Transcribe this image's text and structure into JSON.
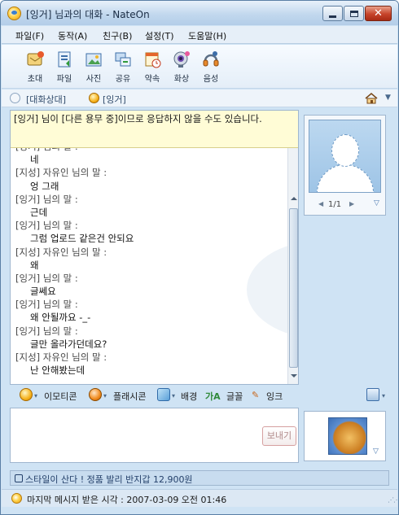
{
  "window": {
    "title": "[잉거] 님과의 대화  - NateOn"
  },
  "menu": [
    {
      "label": "파일(F)"
    },
    {
      "label": "동작(A)"
    },
    {
      "label": "친구(B)"
    },
    {
      "label": "설정(T)"
    },
    {
      "label": "도움말(H)"
    }
  ],
  "toolbar": [
    {
      "label": "초대",
      "icon": "invite-icon"
    },
    {
      "label": "파일",
      "icon": "file-icon"
    },
    {
      "label": "사진",
      "icon": "photo-icon"
    },
    {
      "label": "공유",
      "icon": "share-icon"
    },
    {
      "label": "약속",
      "icon": "appointment-icon"
    },
    {
      "label": "화상",
      "icon": "video-icon"
    },
    {
      "label": "음성",
      "icon": "voice-icon"
    }
  ],
  "conversation_status": {
    "label": "[대화상대]",
    "peer": "[잉거]"
  },
  "notice": "[잉거] 님이 [다른 용무 중]이므로 응답하지 않을 수도 있습니다.",
  "messages": [
    {
      "sender": "[잉거] 님의 말 :",
      "text": "네"
    },
    {
      "sender": "[지성] 자유인 님의 말 :",
      "text": "엉 그래"
    },
    {
      "sender": "[잉거] 님의 말 :",
      "text": "근데"
    },
    {
      "sender": "[잉거] 님의 말 :",
      "text": "그럼 업로드 같은건 안되요"
    },
    {
      "sender": "[지성] 자유인 님의 말 :",
      "text": "왜"
    },
    {
      "sender": "[잉거] 님의 말 :",
      "text": "글쎄요"
    },
    {
      "sender": "[잉거] 님의 말 :",
      "text": "왜 안될까요 -_-"
    },
    {
      "sender": "[잉거] 님의 말 :",
      "text": "글만 올라가던데요?"
    },
    {
      "sender": "[지성] 자유인 님의 말 :",
      "text": "난 안해봤는데"
    }
  ],
  "avatar": {
    "page": "1/1"
  },
  "format_bar": {
    "emoticon": "이모티콘",
    "flashcon": "플래시콘",
    "background": "배경",
    "font": "글꼴",
    "ink": "잉크"
  },
  "input": {
    "send_label": "보내기"
  },
  "ad": {
    "text": "스타일이 산다 ! 정품 발리 반지갑 12,900원"
  },
  "status_bar": {
    "text": "마지막 메시지 받은 시각 : 2007-03-09 오전 01:46"
  }
}
